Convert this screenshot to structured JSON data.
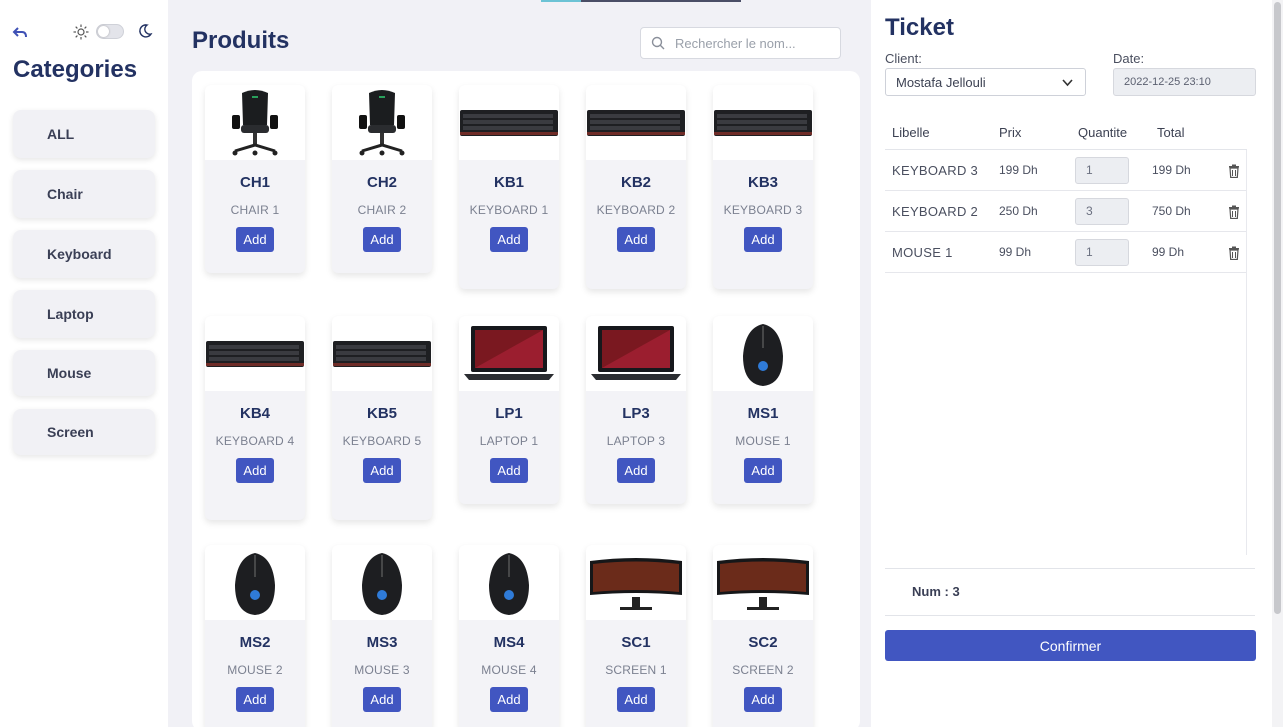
{
  "sidebar": {
    "title": "Categories",
    "items": [
      {
        "label": "ALL"
      },
      {
        "label": "Chair"
      },
      {
        "label": "Keyboard"
      },
      {
        "label": "Laptop"
      },
      {
        "label": "Mouse"
      },
      {
        "label": "Screen"
      }
    ],
    "theme_toggle_on": false
  },
  "main": {
    "title": "Produits",
    "search_placeholder": "Rechercher le nom...",
    "add_label": "Add",
    "products": [
      {
        "code": "CH1",
        "name": "CHAIR 1",
        "icon": "chair-image"
      },
      {
        "code": "CH2",
        "name": "CHAIR 2",
        "icon": "chair-image"
      },
      {
        "code": "KB1",
        "name": "KEYBOARD 1",
        "icon": "keyboard-image"
      },
      {
        "code": "KB2",
        "name": "KEYBOARD 2",
        "icon": "keyboard-image"
      },
      {
        "code": "KB3",
        "name": "KEYBOARD 3",
        "icon": "keyboard-image"
      },
      {
        "code": "KB4",
        "name": "KEYBOARD 4",
        "icon": "keyboard-image"
      },
      {
        "code": "KB5",
        "name": "KEYBOARD 5",
        "icon": "keyboard-image"
      },
      {
        "code": "LP1",
        "name": "LAPTOP 1",
        "icon": "laptop-image"
      },
      {
        "code": "LP3",
        "name": "LAPTOP 3",
        "icon": "laptop-image"
      },
      {
        "code": "MS1",
        "name": "MOUSE 1",
        "icon": "mouse-image"
      },
      {
        "code": "MS2",
        "name": "MOUSE 2",
        "icon": "mouse-image"
      },
      {
        "code": "MS3",
        "name": "MOUSE 3",
        "icon": "mouse-image"
      },
      {
        "code": "MS4",
        "name": "MOUSE 4",
        "icon": "mouse-image"
      },
      {
        "code": "SC1",
        "name": "SCREEN 1",
        "icon": "screen-image"
      },
      {
        "code": "SC2",
        "name": "SCREEN 2",
        "icon": "screen-image"
      }
    ]
  },
  "ticket": {
    "title": "Ticket",
    "client_label": "Client:",
    "client_value": "Mostafa Jellouli",
    "date_label": "Date:",
    "date_value": "2022-12-25 23:10",
    "headers": {
      "libelle": "Libelle",
      "prix": "Prix",
      "quantite": "Quantite",
      "total": "Total"
    },
    "rows": [
      {
        "libelle": "KEYBOARD 3",
        "prix": "199 Dh",
        "quantite": "1",
        "total": "199 Dh"
      },
      {
        "libelle": "KEYBOARD 2",
        "prix": "250 Dh",
        "quantite": "3",
        "total": "750 Dh"
      },
      {
        "libelle": "MOUSE 1",
        "prix": "99 Dh",
        "quantite": "1",
        "total": "99 Dh"
      }
    ],
    "num_label": "Num : 3",
    "confirm_label": "Confirmer"
  },
  "colors": {
    "accent": "#4156c1",
    "heading": "#233262",
    "background": "#f1f1f6"
  }
}
